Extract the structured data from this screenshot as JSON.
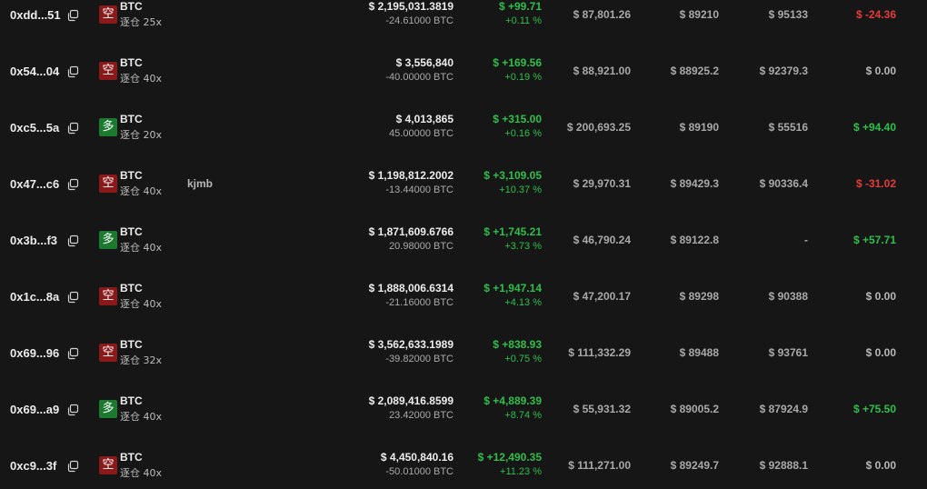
{
  "colors": {
    "background": "#161616",
    "positive": "#2fbf4b",
    "negative": "#e53b3b",
    "short_badge": "#8a1a1a",
    "long_badge": "#1c7a30"
  },
  "rows": [
    {
      "address": "0xdd...51",
      "side": "空",
      "side_type": "short",
      "coin": "BTC",
      "mode": "逐仓 25x",
      "note": "",
      "value": "$ 2,195,031.3819",
      "size": "-24.61000 BTC",
      "pnl": "$ +99.71",
      "pnl_pct": "+0.11 %",
      "pnl_sign": "green",
      "entry": "$ 87,801.26",
      "mark": "$ 89210",
      "liq": "$ 95133",
      "funding": "$ -24.36",
      "funding_sign": "red"
    },
    {
      "address": "0x54...04",
      "side": "空",
      "side_type": "short",
      "coin": "BTC",
      "mode": "逐仓 40x",
      "note": "",
      "value": "$ 3,556,840",
      "size": "-40.00000 BTC",
      "pnl": "$ +169.56",
      "pnl_pct": "+0.19 %",
      "pnl_sign": "green",
      "entry": "$ 88,921.00",
      "mark": "$ 88925.2",
      "liq": "$ 92379.3",
      "funding": "$ 0.00",
      "funding_sign": "neutral"
    },
    {
      "address": "0xc5...5a",
      "side": "多",
      "side_type": "long",
      "coin": "BTC",
      "mode": "逐仓 20x",
      "note": "",
      "value": "$ 4,013,865",
      "size": "45.00000 BTC",
      "pnl": "$ +315.00",
      "pnl_pct": "+0.16 %",
      "pnl_sign": "green",
      "entry": "$ 200,693.25",
      "mark": "$ 89190",
      "liq": "$ 55516",
      "funding": "$ +94.40",
      "funding_sign": "green"
    },
    {
      "address": "0x47...c6",
      "side": "空",
      "side_type": "short",
      "coin": "BTC",
      "mode": "逐仓 40x",
      "note": "kjmb",
      "value": "$ 1,198,812.2002",
      "size": "-13.44000 BTC",
      "pnl": "$ +3,109.05",
      "pnl_pct": "+10.37 %",
      "pnl_sign": "green",
      "entry": "$ 29,970.31",
      "mark": "$ 89429.3",
      "liq": "$ 90336.4",
      "funding": "$ -31.02",
      "funding_sign": "red"
    },
    {
      "address": "0x3b...f3",
      "side": "多",
      "side_type": "long",
      "coin": "BTC",
      "mode": "逐仓 40x",
      "note": "",
      "value": "$ 1,871,609.6766",
      "size": "20.98000 BTC",
      "pnl": "$ +1,745.21",
      "pnl_pct": "+3.73 %",
      "pnl_sign": "green",
      "entry": "$ 46,790.24",
      "mark": "$ 89122.8",
      "liq": "-",
      "funding": "$ +57.71",
      "funding_sign": "green"
    },
    {
      "address": "0x1c...8a",
      "side": "空",
      "side_type": "short",
      "coin": "BTC",
      "mode": "逐仓 40x",
      "note": "",
      "value": "$ 1,888,006.6314",
      "size": "-21.16000 BTC",
      "pnl": "$ +1,947.14",
      "pnl_pct": "+4.13 %",
      "pnl_sign": "green",
      "entry": "$ 47,200.17",
      "mark": "$ 89298",
      "liq": "$ 90388",
      "funding": "$ 0.00",
      "funding_sign": "neutral"
    },
    {
      "address": "0x69...96",
      "side": "空",
      "side_type": "short",
      "coin": "BTC",
      "mode": "逐仓 32x",
      "note": "",
      "value": "$ 3,562,633.1989",
      "size": "-39.82000 BTC",
      "pnl": "$ +838.93",
      "pnl_pct": "+0.75 %",
      "pnl_sign": "green",
      "entry": "$ 111,332.29",
      "mark": "$ 89488",
      "liq": "$ 93761",
      "funding": "$ 0.00",
      "funding_sign": "neutral"
    },
    {
      "address": "0x69...a9",
      "side": "多",
      "side_type": "long",
      "coin": "BTC",
      "mode": "逐仓 40x",
      "note": "",
      "value": "$ 2,089,416.8599",
      "size": "23.42000 BTC",
      "pnl": "$ +4,889.39",
      "pnl_pct": "+8.74 %",
      "pnl_sign": "green",
      "entry": "$ 55,931.32",
      "mark": "$ 89005.2",
      "liq": "$ 87924.9",
      "funding": "$ +75.50",
      "funding_sign": "green"
    },
    {
      "address": "0xc9...3f",
      "side": "空",
      "side_type": "short",
      "coin": "BTC",
      "mode": "逐仓 40x",
      "note": "",
      "value": "$ 4,450,840.16",
      "size": "-50.01000 BTC",
      "pnl": "$ +12,490.35",
      "pnl_pct": "+11.23 %",
      "pnl_sign": "green",
      "entry": "$ 111,271.00",
      "mark": "$ 89249.7",
      "liq": "$ 92888.1",
      "funding": "$ 0.00",
      "funding_sign": "neutral"
    }
  ]
}
